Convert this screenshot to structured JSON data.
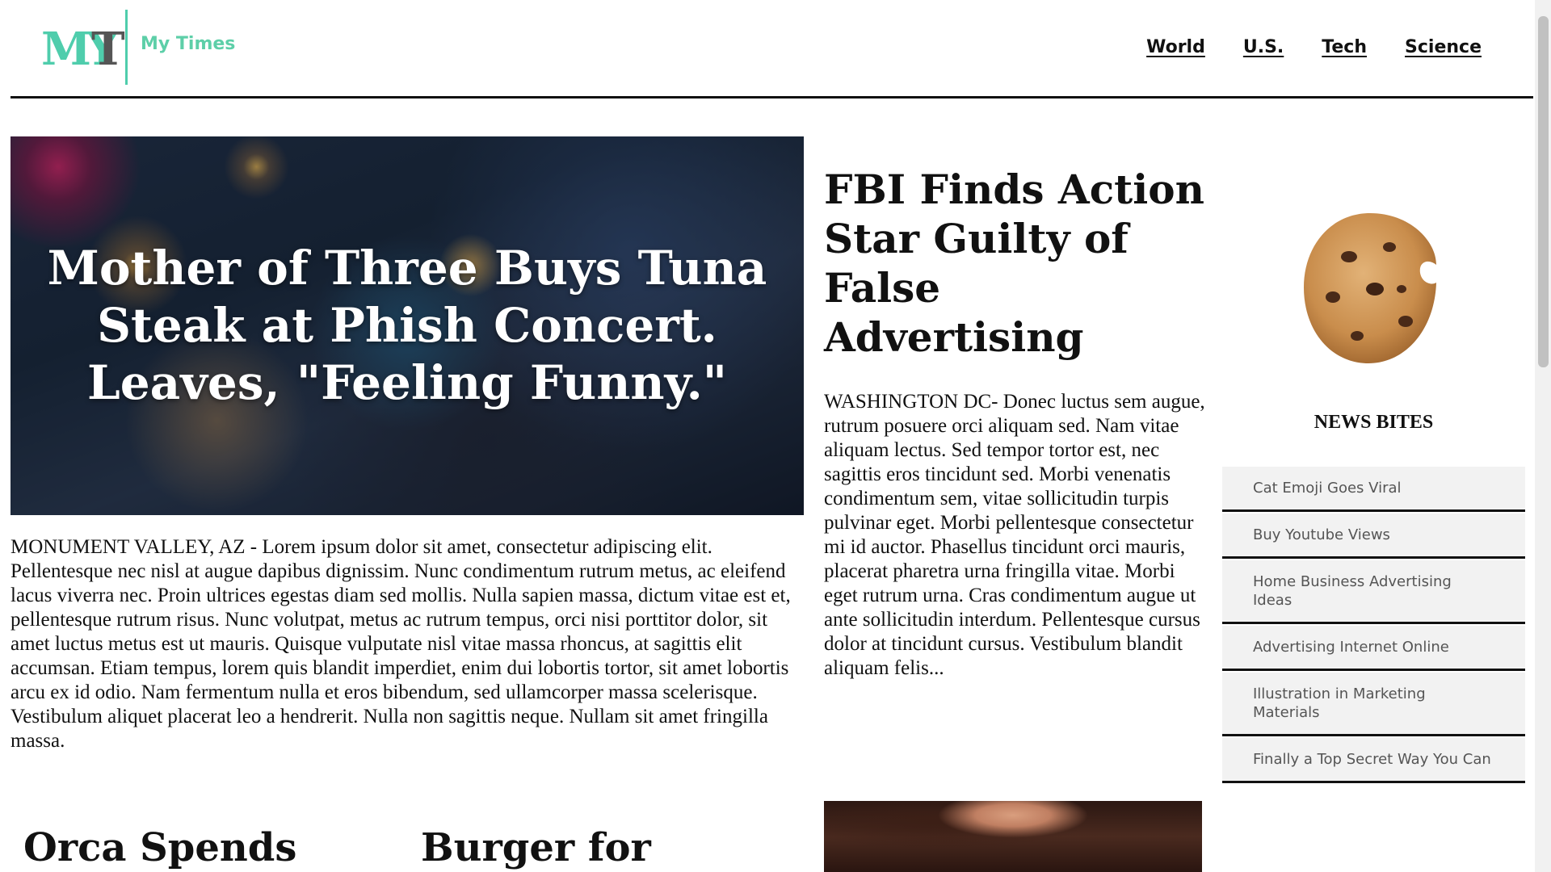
{
  "header": {
    "logo_mark": "MYT",
    "site_name": "My Times",
    "nav": [
      "World",
      "U.S.",
      "Tech",
      "Science"
    ],
    "accent_color": "#5dcfa8"
  },
  "hero": {
    "title": "Mother of Three Buys Tuna Steak at Phish Concert. Leaves, \"Feeling Funny.\"",
    "body": "MONUMENT VALLEY, AZ - Lorem ipsum dolor sit amet, consectetur adipiscing elit. Pellentesque nec nisl at augue dapibus dignissim. Nunc condimentum rutrum metus, ac eleifend lacus viverra nec. Proin ultrices egestas diam sed mollis. Nulla sapien massa, dictum vitae est et, pellentesque rutrum risus. Nunc volutpat, metus ac rutrum tempus, orci nisi porttitor dolor, sit amet luctus metus est ut mauris. Quisque vulputate nisl vitae massa rhoncus, at sagittis elit accumsan. Etiam tempus, lorem quis blandit imperdiet, enim dui lobortis tortor, sit amet lobortis arcu ex id odio. Nam fermentum nulla et eros bibendum, sed ullamcorper massa scelerisque. Vestibulum aliquet placerat leo a hendrerit. Nulla non sagittis neque. Nullam sit amet fringilla massa."
  },
  "secondary": {
    "orca_title": "Orca Spends",
    "burger_title": "Burger for"
  },
  "feature": {
    "title": "FBI Finds Action Star Guilty of False Advertising",
    "body": "WASHINGTON DC- Donec luctus sem augue, rutrum posuere orci aliquam sed. Nam vitae aliquam lectus. Sed tempor tortor est, nec sagittis eros tincidunt sed. Morbi venenatis condimentum sem, vitae sollicitudin turpis pulvinar eget. Morbi pellentesque consectetur mi id auctor. Phasellus tincidunt orci mauris, placerat pharetra urna fringilla vitae. Morbi eget rutrum urna. Cras condimentum augue ut ante sollicitudin interdum. Pellentesque cursus dolor at tincidunt cursus. Vestibulum blandit aliquam felis..."
  },
  "sidebar": {
    "heading": "NEWS BITES",
    "items": [
      "Cat Emoji Goes Viral",
      "Buy Youtube Views",
      "Home Business Advertising Ideas",
      "Advertising Internet Online",
      "Illustration in Marketing Materials",
      "Finally a Top Secret Way You Can"
    ]
  }
}
